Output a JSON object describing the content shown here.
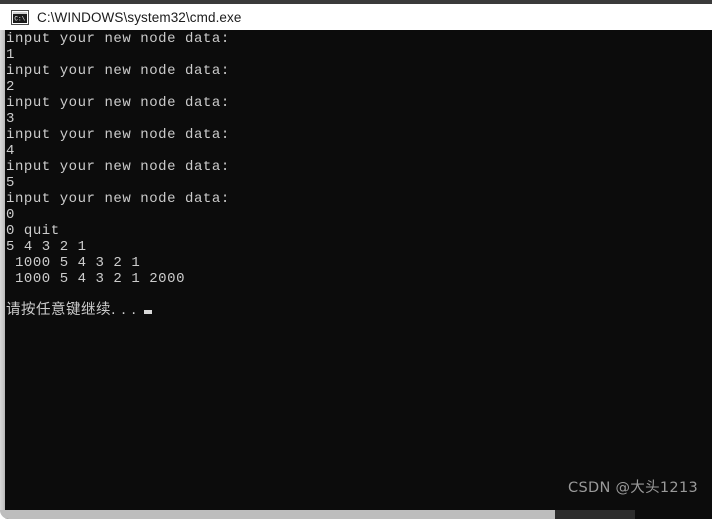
{
  "window": {
    "title": "C:\\WINDOWS\\system32\\cmd.exe",
    "icon": "cmd-console-icon",
    "background_color": "#0c0c0c",
    "text_color": "#cccccc",
    "titlebar_color": "#ffffff"
  },
  "console": {
    "lines": [
      "input your new node data:",
      "1",
      "input your new node data:",
      "2",
      "input your new node data:",
      "3",
      "input your new node data:",
      "4",
      "input your new node data:",
      "5",
      "input your new node data:",
      "0",
      "0 quit",
      "5 4 3 2 1",
      " 1000 5 4 3 2 1",
      " 1000 5 4 3 2 1 2000"
    ],
    "prompt": "请按任意键继续. . .",
    "cursor": "block-cursor"
  },
  "watermark": {
    "text": "CSDN @大头1213"
  }
}
